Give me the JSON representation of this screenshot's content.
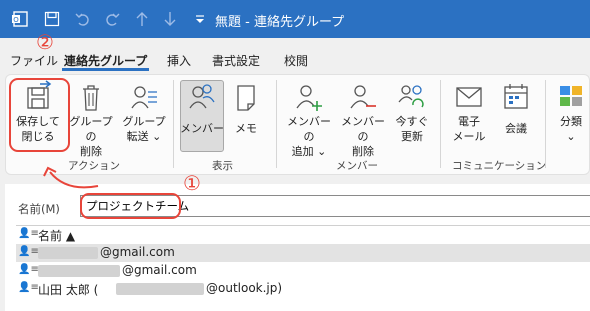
{
  "window": {
    "title": "無題 - 連絡先グループ"
  },
  "menu": {
    "items": [
      "ファイル",
      "連絡先グループ",
      "挿入",
      "書式設定",
      "校閲"
    ]
  },
  "ribbon": {
    "save_close": [
      "保存して",
      "閉じる"
    ],
    "delete_group": [
      "グループの",
      "削除"
    ],
    "forward_group": [
      "グループ",
      "転送 ⌄"
    ],
    "members": "メンバー",
    "memo": "メモ",
    "add_member": [
      "メンバーの",
      "追加 ⌄"
    ],
    "remove_member": [
      "メンバーの",
      "削除"
    ],
    "update_now": [
      "今すぐ",
      "更新"
    ],
    "email": [
      "電子",
      "メール"
    ],
    "meeting": "会議",
    "categorize": [
      "分類",
      "⌄"
    ],
    "groups": [
      "アクション",
      "表示",
      "メンバー",
      "コミュニケーション"
    ]
  },
  "form": {
    "name_label": "名前(M)",
    "name_value": "プロジェクトチーム"
  },
  "list": {
    "header": "名前 ▲",
    "rows": [
      {
        "suffix": "@gmail.com"
      },
      {
        "suffix": "@gmail.com"
      },
      {
        "prefix": "山田 太郎 (",
        "suffix": "@outlook.jp)"
      }
    ]
  },
  "annotations": {
    "one": "①",
    "two": "②"
  },
  "colors": {
    "titlebar": "#2b71c2",
    "annotation": "#e8453a",
    "accent": "#2b71c2"
  }
}
